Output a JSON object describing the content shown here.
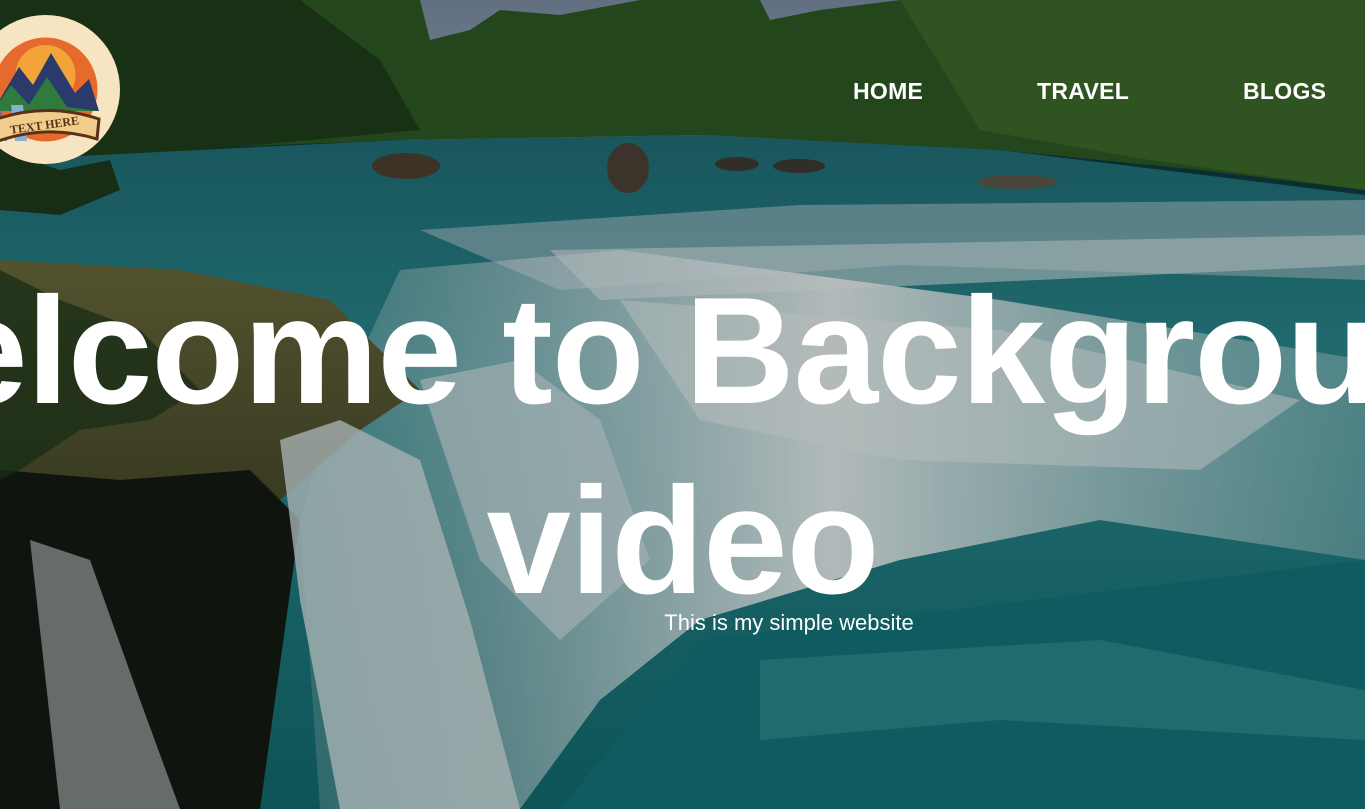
{
  "logo": {
    "text": "TEXT HERE",
    "icon": "mountain-badge-icon",
    "bg_color": "#f6e5c0"
  },
  "nav": {
    "items": [
      {
        "label": "HOME"
      },
      {
        "label": "TRAVEL"
      },
      {
        "label": "BLOGS"
      }
    ]
  },
  "hero": {
    "title_line1": "Welcome to Background",
    "title_line2": "video",
    "subtitle": "This is my simple website"
  },
  "background": {
    "type": "video",
    "scene": "waterfall",
    "colors": {
      "water": "#2e8a8c",
      "foliage": "#2f5a26",
      "foam": "#dfe9ea"
    }
  }
}
